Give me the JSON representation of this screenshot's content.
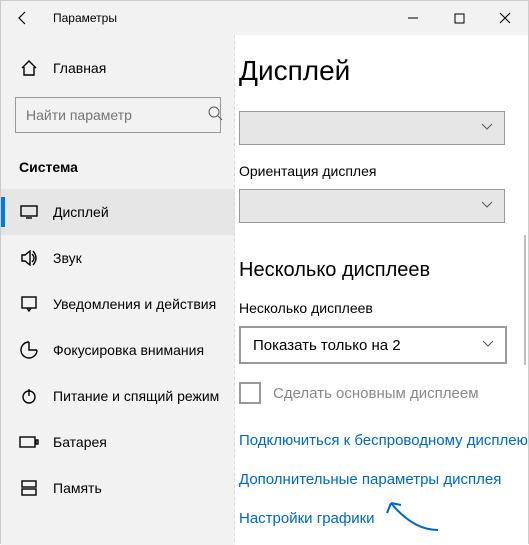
{
  "titlebar": {
    "title": "Параметры"
  },
  "sidebar": {
    "home": "Главная",
    "search_placeholder": "Найти параметр",
    "section": "Система",
    "items": [
      {
        "label": "Дисплей"
      },
      {
        "label": "Звук"
      },
      {
        "label": "Уведомления и действия"
      },
      {
        "label": "Фокусировка внимания"
      },
      {
        "label": "Питание и спящий режим"
      },
      {
        "label": "Батарея"
      },
      {
        "label": "Память"
      }
    ]
  },
  "main": {
    "title": "Дисплей",
    "orientation_label": "Ориентация дисплея",
    "multi_head": "Несколько дисплеев",
    "multi_label": "Несколько дисплеев",
    "multi_value": "Показать только на 2",
    "make_primary": "Сделать основным дисплеем",
    "link_wireless": "Подключиться к беспроводному дисплею",
    "link_advanced": "Дополнительные параметры дисплея",
    "link_graphics": "Настройки графики"
  }
}
